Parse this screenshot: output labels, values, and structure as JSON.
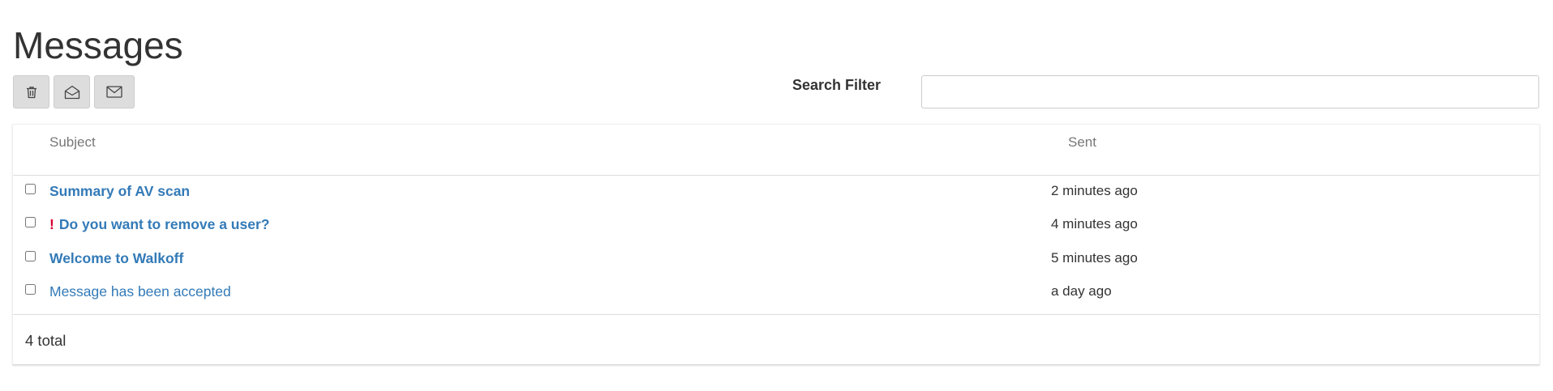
{
  "page": {
    "title": "Messages"
  },
  "toolbar": {
    "buttons": [
      {
        "icon": "trash-icon",
        "action": "delete"
      },
      {
        "icon": "envelope-open-icon",
        "action": "mark-read"
      },
      {
        "icon": "envelope-icon",
        "action": "mark-unread"
      }
    ]
  },
  "search": {
    "label": "Search Filter",
    "value": "",
    "placeholder": ""
  },
  "table": {
    "columns": {
      "subject": "Subject",
      "sent": "Sent"
    },
    "rows": [
      {
        "subject": "Summary of AV scan",
        "sent": "2 minutes ago",
        "unread": true,
        "important": false,
        "checked": false
      },
      {
        "subject": "Do you want to remove a user?",
        "sent": "4 minutes ago",
        "unread": true,
        "important": true,
        "important_mark": "!",
        "checked": false
      },
      {
        "subject": "Welcome to Walkoff",
        "sent": "5 minutes ago",
        "unread": true,
        "important": false,
        "checked": false
      },
      {
        "subject": "Message has been accepted",
        "sent": "a day ago",
        "unread": false,
        "important": false,
        "checked": false
      }
    ],
    "footer": {
      "total": "4 total"
    }
  },
  "colors": {
    "link": "#337ab7",
    "important": "#d9002f",
    "button_bg": "#dddddd",
    "header_text": "#777777"
  }
}
